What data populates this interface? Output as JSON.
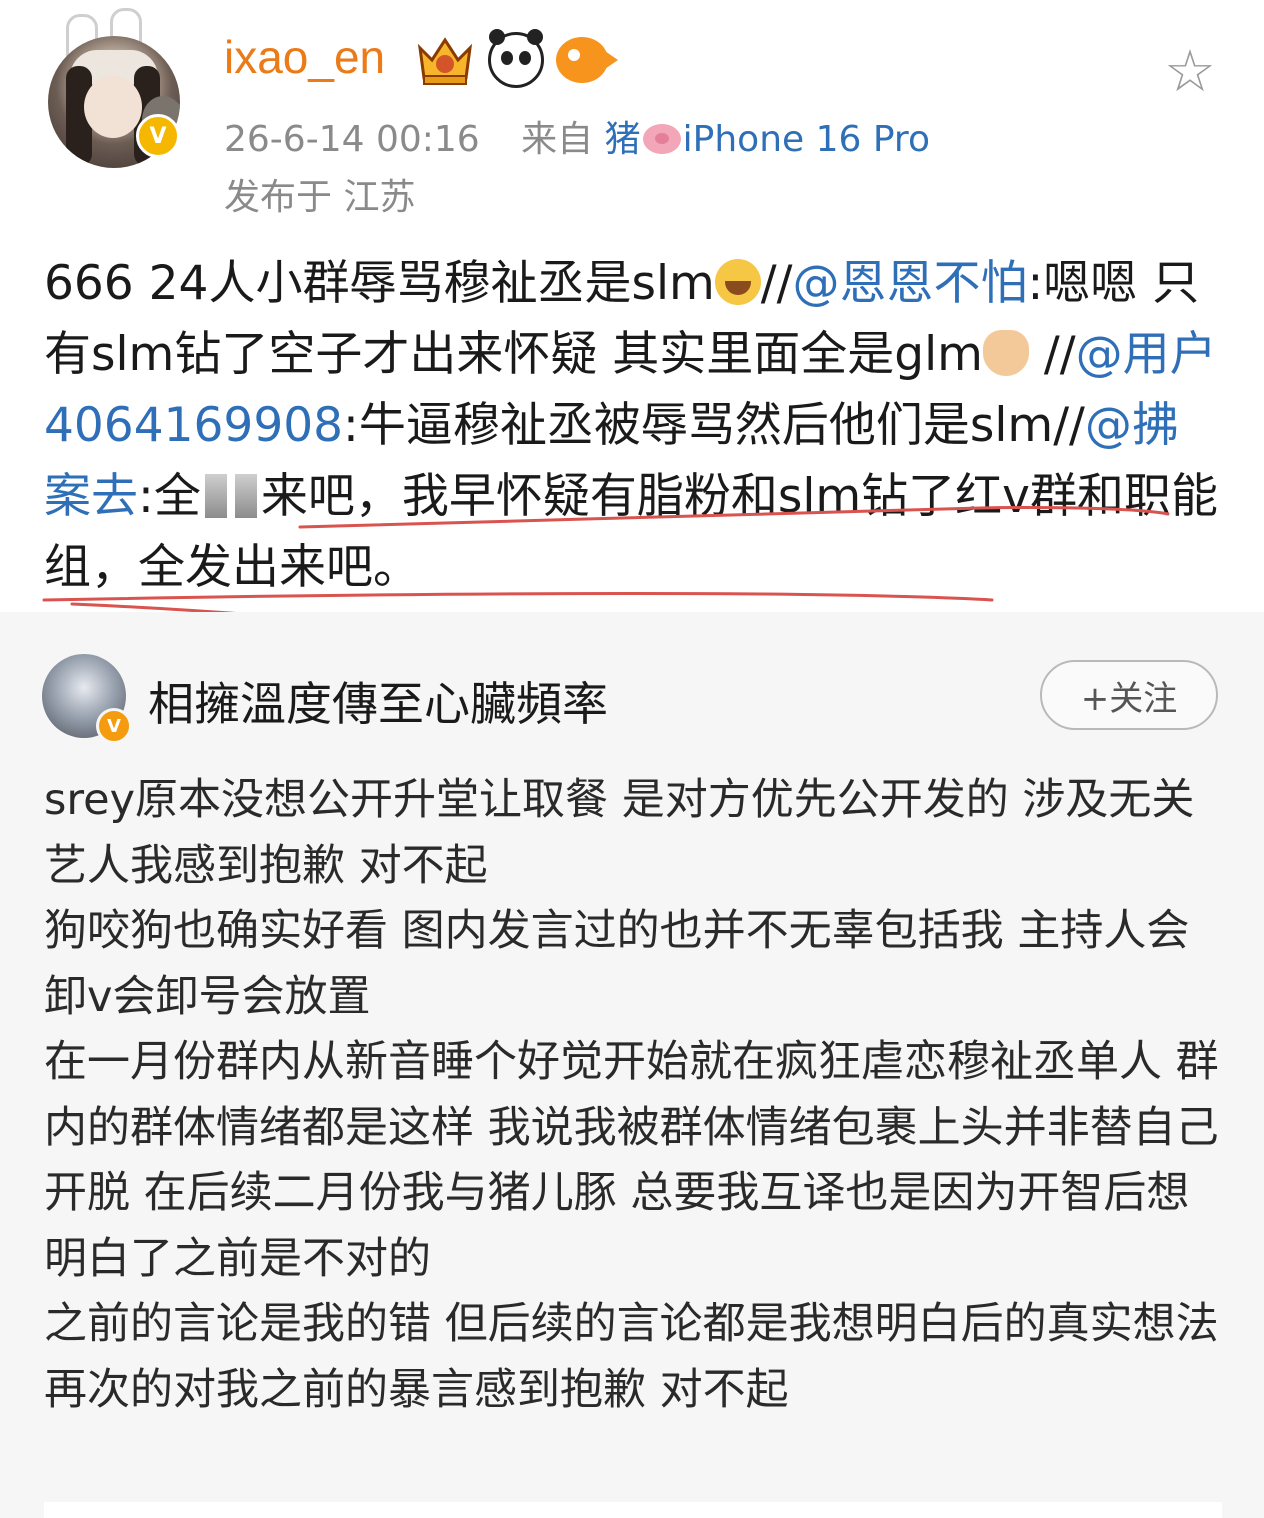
{
  "header": {
    "username": "ixao_en",
    "timestamp": "26-6-14 00:16",
    "source_prefix": "来自",
    "source_name_a": "猪",
    "source_name_b": "iPhone 16 Pro",
    "location": "发布于 江苏",
    "star_icon": "☆",
    "verified_mark": "V"
  },
  "repost": {
    "seg1": "666 24人小群辱骂穆祉丞是slm",
    "seg2": "//",
    "mention1": "@恩恩不怕",
    "seg3": ":嗯嗯 只有slm钻了空子才出来怀疑 其实里面全是glm",
    "seg4": " //",
    "mention2": "@用户4064169908",
    "seg5": ":牛逼穆祉丞被辱骂然后他们是slm//",
    "mention3": "@拂案去",
    "seg6": ":全",
    "seg7": "来吧，我早怀疑有脂粉和slm钻了红v群和职能组，全发出来吧。"
  },
  "quoted": {
    "author": "相擁溫度傳至心臟頻率",
    "follow_label": "+关注",
    "verified_mark": "V",
    "paragraphs": [
      "srey原本没想公开升堂让取餐  是对方优先公开发的  涉及无关艺人我感到抱歉  对不起",
      "狗咬狗也确实好看  图内发言过的也并不无辜包括我  主持人会卸v会卸号会放置",
      "在一月份群内从新音睡个好觉开始就在疯狂虐恋穆祉丞单人  群内的群体情绪都是这样  我说我被群体情绪包裹上头并非替自己开脱   在后续二月份我与猪儿豚 总要我互译也是因为开智后想明白了之前是不对的",
      "之前的言论是我的错  但后续的言论都是我想明白后的真实想法",
      "再次的对我之前的暴言感到抱歉  对不起"
    ]
  },
  "colors": {
    "username": "#eb7a19",
    "mention": "#2e6fb8",
    "underline": "#d9534f",
    "quoted_bg": "#f6f6f6"
  }
}
